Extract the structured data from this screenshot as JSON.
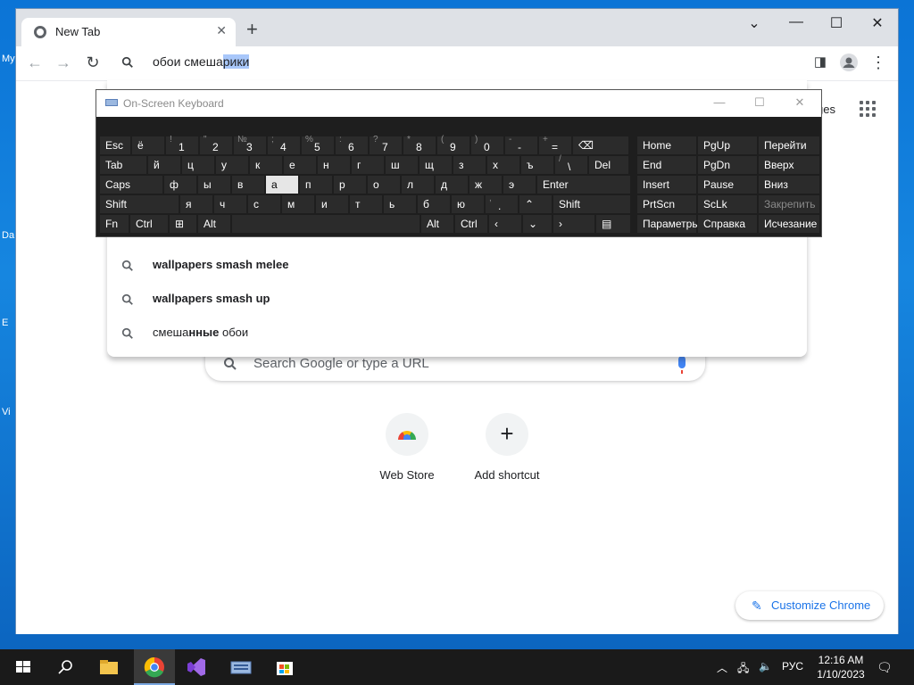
{
  "desktop": {
    "icons": [
      "My",
      "Da",
      "E",
      "Vi"
    ]
  },
  "browser": {
    "tab_title": "New Tab",
    "omnibox": {
      "text_prefix": "обои смеша",
      "text_selected": "рики"
    },
    "images_link": "ges",
    "suggestions": [
      {
        "bold": "wallpapers smash melee",
        "normal": ""
      },
      {
        "bold": "wallpapers smash up",
        "normal": ""
      },
      {
        "normal_pre": "смеша",
        "bold": "нные",
        "normal": " обои"
      }
    ],
    "search_placeholder": "Search Google or type a URL",
    "shortcuts": [
      {
        "label": "Web Store"
      },
      {
        "label": "Add shortcut"
      }
    ],
    "customize_label": "Customize Chrome"
  },
  "osk": {
    "title": "On-Screen Keyboard",
    "row1": [
      {
        "main": "Esc"
      },
      {
        "main": "ё"
      },
      {
        "sub": "!",
        "low": "1"
      },
      {
        "sub": "\"",
        "low": "2"
      },
      {
        "sub": "№",
        "low": "3"
      },
      {
        "sub": ";",
        "low": "4"
      },
      {
        "sub": "%",
        "low": "5"
      },
      {
        "sub": ":",
        "low": "6"
      },
      {
        "sub": "?",
        "low": "7"
      },
      {
        "sub": "*",
        "low": "8"
      },
      {
        "sub": "(",
        "low": "9"
      },
      {
        "sub": ")",
        "low": "0"
      },
      {
        "sub": "-",
        "low": "-"
      },
      {
        "sub": "+",
        "low": "="
      },
      {
        "main": "⌫"
      }
    ],
    "row2": [
      {
        "main": "Tab"
      },
      {
        "main": "й"
      },
      {
        "main": "ц"
      },
      {
        "main": "у"
      },
      {
        "main": "к"
      },
      {
        "main": "е"
      },
      {
        "main": "н"
      },
      {
        "main": "г"
      },
      {
        "main": "ш"
      },
      {
        "main": "щ"
      },
      {
        "main": "з"
      },
      {
        "main": "х"
      },
      {
        "main": "ъ"
      },
      {
        "sub": "/",
        "low": "\\"
      },
      {
        "main": "Del"
      }
    ],
    "row3": [
      {
        "main": "Caps"
      },
      {
        "main": "ф"
      },
      {
        "main": "ы"
      },
      {
        "main": "в"
      },
      {
        "main": "а"
      },
      {
        "main": "п"
      },
      {
        "main": "р"
      },
      {
        "main": "о"
      },
      {
        "main": "л"
      },
      {
        "main": "д"
      },
      {
        "main": "ж"
      },
      {
        "main": "э"
      },
      {
        "main": "Enter"
      }
    ],
    "row4": [
      {
        "main": "Shift"
      },
      {
        "main": "я"
      },
      {
        "main": "ч"
      },
      {
        "main": "с"
      },
      {
        "main": "м"
      },
      {
        "main": "и"
      },
      {
        "main": "т"
      },
      {
        "main": "ь"
      },
      {
        "main": "б"
      },
      {
        "main": "ю"
      },
      {
        "sub": ",",
        "low": "."
      },
      {
        "main": "⌃"
      },
      {
        "main": "Shift"
      }
    ],
    "row5": [
      {
        "main": "Fn"
      },
      {
        "main": "Ctrl"
      },
      {
        "main": "⊞"
      },
      {
        "main": "Alt"
      },
      {
        "main": ""
      },
      {
        "main": "Alt"
      },
      {
        "main": "Ctrl"
      },
      {
        "main": "‹"
      },
      {
        "main": "⌄"
      },
      {
        "main": "›"
      },
      {
        "main": "▤"
      }
    ],
    "nav": [
      [
        "Home",
        "PgUp",
        "Перейти"
      ],
      [
        "End",
        "PgDn",
        "Вверх"
      ],
      [
        "Insert",
        "Pause",
        "Вниз"
      ],
      [
        "PrtScn",
        "ScLk",
        "Закрепить"
      ],
      [
        "Параметры",
        "Справка",
        "Исчезание"
      ]
    ]
  },
  "taskbar": {
    "lang": "РУС",
    "time": "12:16 AM",
    "date": "1/10/2023"
  }
}
